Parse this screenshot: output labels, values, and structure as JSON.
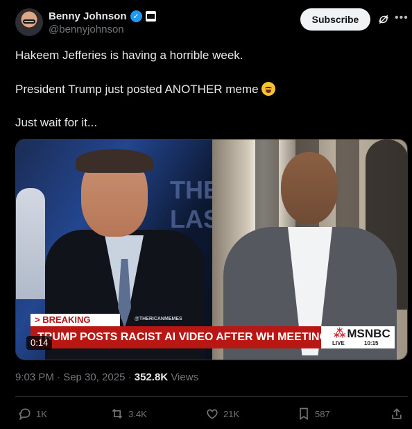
{
  "author": {
    "name": "Benny Johnson",
    "handle": "@bennyjohnson"
  },
  "buttons": {
    "subscribe": "Subscribe"
  },
  "post": {
    "lines": [
      "Hakeem Jefferies is having a horrible week.",
      "President Trump just posted ANOTHER meme",
      "Just wait for it..."
    ],
    "emoji": "rolling-on-the-floor-laughing-emoji"
  },
  "video": {
    "background_text": "THE LAS",
    "breaking_label": "> BREAKING NEWS",
    "source_handle": "@THERICANMEMES",
    "headline": "TRUMP POSTS RACIST AI VIDEO AFTER WH MEETING W/ DEMS",
    "network": "MSNBC",
    "live_label": "LIVE",
    "live_time": "10:15",
    "duration": "0:14"
  },
  "meta": {
    "timestamp": "9:03 PM · Sep 30, 2025 · ",
    "views_count": "352.8K",
    "views_label": " Views"
  },
  "actions": {
    "replies": "1K",
    "reposts": "3.4K",
    "likes": "21K",
    "bookmarks": "587"
  },
  "icons": {
    "verified": "verified-check-icon",
    "affiliate": "affiliate-badge-icon",
    "grok": "grok-icon",
    "more": "more-icon",
    "reply": "reply-icon",
    "repost": "repost-icon",
    "like": "like-icon",
    "bookmark": "bookmark-icon",
    "share": "share-icon"
  },
  "colors": {
    "background": "#000000",
    "text": "#e7e9ea",
    "muted": "#71767b",
    "verified": "#1d9bf0",
    "breaking_red": "#b91714"
  }
}
